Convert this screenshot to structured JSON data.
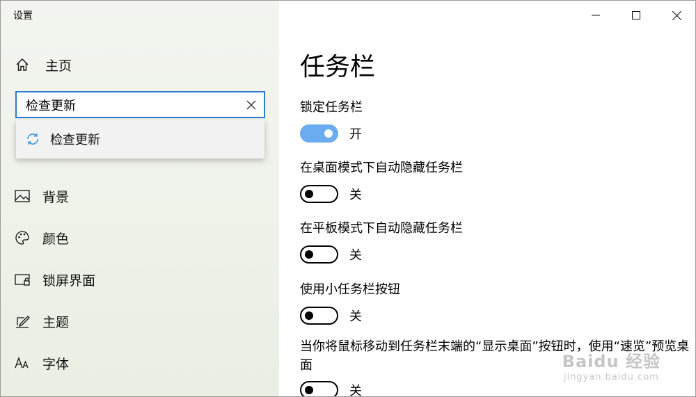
{
  "window": {
    "title": "设置",
    "controls": {
      "minimize": "minimize",
      "maximize": "maximize",
      "close": "close"
    }
  },
  "sidebar": {
    "home_label": "主页",
    "search": {
      "value": "检查更新",
      "placeholder": ""
    },
    "suggestion": "检查更新",
    "items": [
      {
        "label": "背景",
        "icon": "picture-icon"
      },
      {
        "label": "颜色",
        "icon": "palette-icon"
      },
      {
        "label": "锁屏界面",
        "icon": "lock-screen-icon"
      },
      {
        "label": "主题",
        "icon": "theme-brush-icon"
      },
      {
        "label": "字体",
        "icon": "font-icon"
      }
    ]
  },
  "main": {
    "title": "任务栏",
    "settings": [
      {
        "label": "锁定任务栏",
        "state": "开",
        "on": true
      },
      {
        "label": "在桌面模式下自动隐藏任务栏",
        "state": "关",
        "on": false
      },
      {
        "label": "在平板模式下自动隐藏任务栏",
        "state": "关",
        "on": false
      },
      {
        "label": "使用小任务栏按钮",
        "state": "关",
        "on": false
      },
      {
        "label": "当你将鼠标移动到任务栏末端的“显示桌面”按钮时，使用“速览”预览桌面",
        "state": "关",
        "on": false
      }
    ]
  },
  "watermark": {
    "logo": "Baidu 经验",
    "url": "jingyan.baidu.com"
  },
  "colors": {
    "accent": "#2a7cd6",
    "toggle_on": "#6aacef",
    "sidebar_bg": "#eff2ea"
  }
}
